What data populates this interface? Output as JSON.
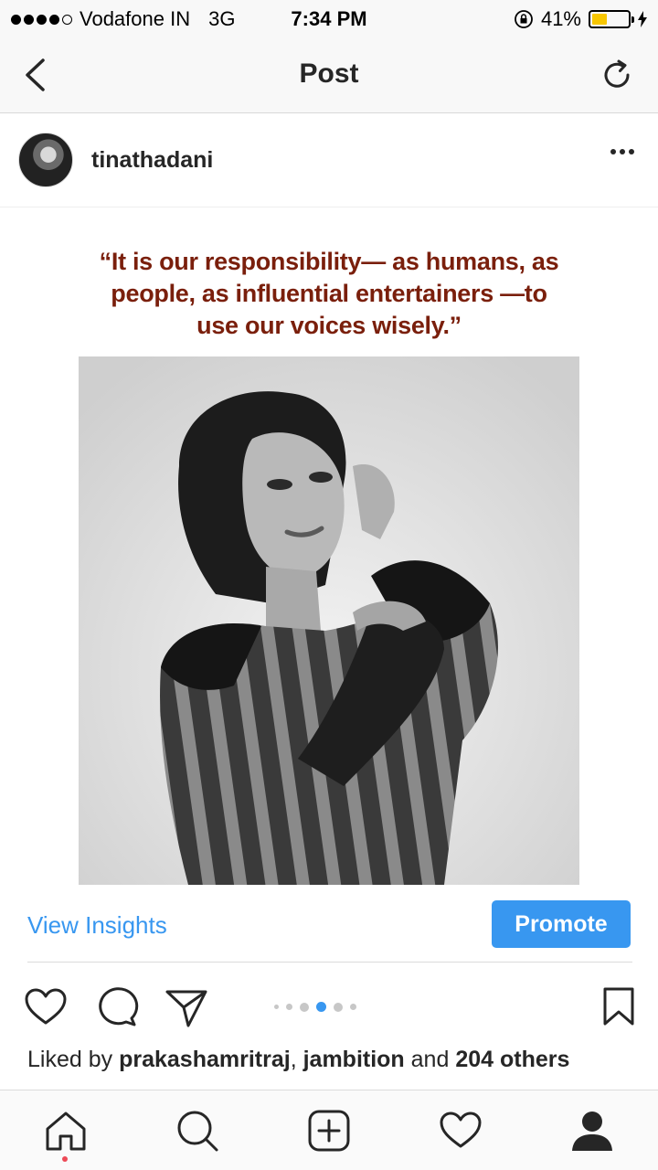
{
  "status_bar": {
    "carrier": "Vodafone IN",
    "network": "3G",
    "time": "7:34 PM",
    "battery": "41%",
    "battery_level": 0.41
  },
  "nav": {
    "title": "Post",
    "back_icon": "chevron-left-icon",
    "refresh_icon": "refresh-icon"
  },
  "post": {
    "username": "tinathadani",
    "quote": "“It is our responsibility— as humans, as people, as influential entertainers —to use our voices wisely.”",
    "carousel_active_index": 3,
    "carousel_count": 6
  },
  "insights": {
    "view_insights_label": "View Insights",
    "promote_label": "Promote"
  },
  "likes": {
    "prefix": "Liked by",
    "user1": "prakashamritraj",
    "sep": ",",
    "user2": "jambition",
    "and": "and",
    "others": "204 others"
  },
  "colors": {
    "accent": "#3897f0",
    "quote": "#7a1f0c",
    "notification_dot": "#ed4956",
    "battery_fill": "#f7c600"
  }
}
